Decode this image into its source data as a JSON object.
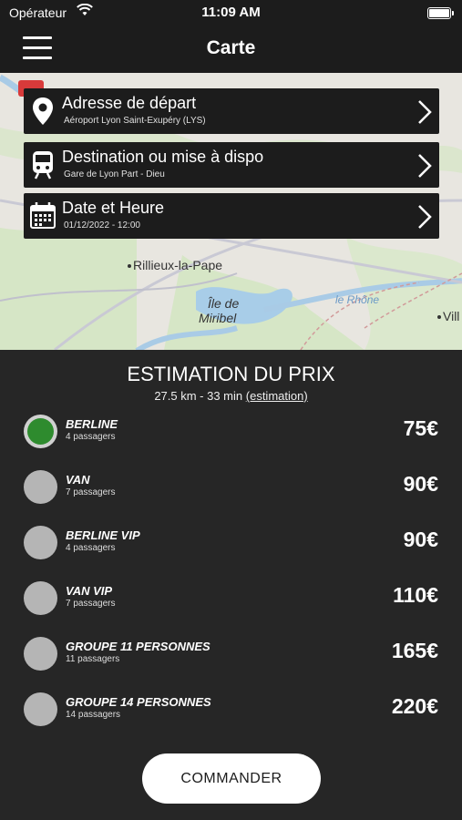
{
  "status": {
    "carrier": "Opérateur",
    "time": "11:09 AM"
  },
  "nav": {
    "title": "Carte"
  },
  "map": {
    "labels": {
      "rillieux": "Rillieux-la-Pape",
      "ile1": "Île de",
      "ile2": "Miribel",
      "rhone": "le Rhône",
      "vill": "Vill"
    }
  },
  "fields": {
    "departure": {
      "label": "Adresse de départ",
      "value": "Aéroport Lyon Saint-Exupéry (LYS)"
    },
    "destination": {
      "label": "Destination ou mise à dispo",
      "value": "Gare de Lyon Part - Dieu"
    },
    "datetime": {
      "label": "Date et Heure",
      "value": "01/12/2022 - 12:00"
    }
  },
  "estimate": {
    "title": "ESTIMATION DU PRIX",
    "distance": "27.5 km - 33 min",
    "link": "(estimation)"
  },
  "options": [
    {
      "name": "BERLINE",
      "capacity": "4 passagers",
      "price": "75€",
      "selected": true
    },
    {
      "name": "VAN",
      "capacity": "7 passagers",
      "price": "90€",
      "selected": false
    },
    {
      "name": "BERLINE VIP",
      "capacity": "4 passagers",
      "price": "90€",
      "selected": false
    },
    {
      "name": "VAN VIP",
      "capacity": "7 passagers",
      "price": "110€",
      "selected": false
    },
    {
      "name": "GROUPE 11 PERSONNES",
      "capacity": "11 passagers",
      "price": "165€",
      "selected": false
    },
    {
      "name": "GROUPE 14 PERSONNES",
      "capacity": "14 passagers",
      "price": "220€",
      "selected": false
    }
  ],
  "order_button": "COMMANDER",
  "colors": {
    "selected_radio": "#2e8b2e",
    "background": "#262626",
    "field_bg": "#1c1c1c"
  }
}
